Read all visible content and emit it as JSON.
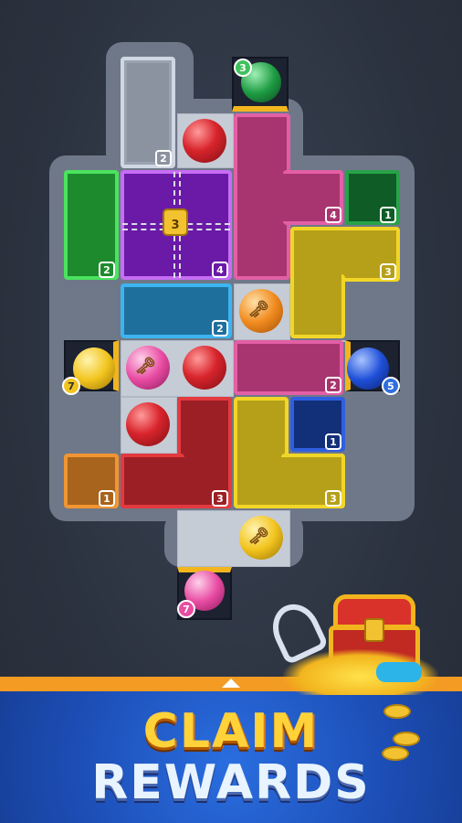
{
  "board": {
    "blocks": [
      {
        "name": "clear-block",
        "count": "2"
      },
      {
        "name": "purple-locked-block",
        "count": "4",
        "lock": "3"
      },
      {
        "name": "green-block-left",
        "count": "2"
      },
      {
        "name": "pink-tall-block",
        "count": "4"
      },
      {
        "name": "darkgreen-block",
        "count": "1"
      },
      {
        "name": "yellow-l-block",
        "count": "3"
      },
      {
        "name": "blue-block",
        "count": "2"
      },
      {
        "name": "pink-short-block",
        "count": "2"
      },
      {
        "name": "orange-block",
        "count": "1"
      },
      {
        "name": "red-l-block",
        "count": "3"
      },
      {
        "name": "yellow-block",
        "count": "3"
      },
      {
        "name": "navy-block",
        "count": "1"
      }
    ],
    "exits": [
      {
        "name": "top-exit-green",
        "count": "3"
      },
      {
        "name": "left-exit-yellow",
        "count": "7"
      },
      {
        "name": "right-exit-blue",
        "count": "5"
      },
      {
        "name": "bottom-exit-pink",
        "count": "7"
      }
    ]
  },
  "banner": {
    "line1": "CLAIM",
    "line2": "REWARDS"
  },
  "colors": {
    "accent": "#f39b22",
    "banner": "#1d4fb8"
  }
}
